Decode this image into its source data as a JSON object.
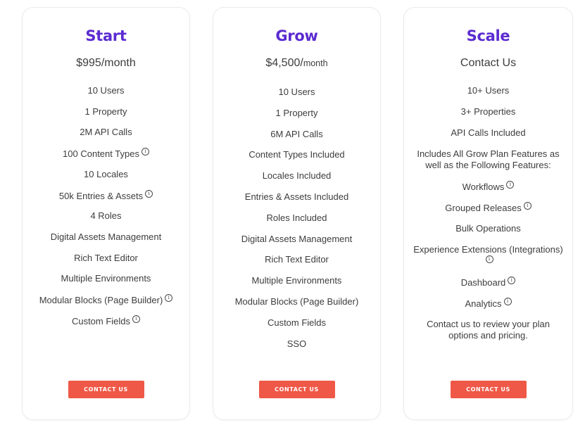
{
  "plans": [
    {
      "title": "Start",
      "price": "$995/month",
      "price_main": "$995/month",
      "price_unit": "",
      "features": [
        {
          "text": "10 Users",
          "info": false
        },
        {
          "text": "1 Property",
          "info": false
        },
        {
          "text": "2M API Calls",
          "info": false
        },
        {
          "text": "100 Content Types",
          "info": true
        },
        {
          "text": "10 Locales",
          "info": false
        },
        {
          "text": "50k Entries & Assets",
          "info": true
        },
        {
          "text": "4 Roles",
          "info": false
        },
        {
          "text": "Digital Assets Management",
          "info": false
        },
        {
          "text": "Rich Text Editor",
          "info": false
        },
        {
          "text": "Multiple Environments",
          "info": false
        },
        {
          "text": "Modular Blocks (Page Builder)",
          "info": true
        },
        {
          "text": "Custom Fields",
          "info": true
        }
      ],
      "cta_label": "CONTACT US"
    },
    {
      "title": "Grow",
      "price_main": "$4,500/",
      "price_unit": "month",
      "features": [
        {
          "text": "10 Users",
          "info": false
        },
        {
          "text": "1 Property",
          "info": false
        },
        {
          "text": "6M API Calls",
          "info": false
        },
        {
          "text": "Content Types Included",
          "info": false
        },
        {
          "text": "Locales Included",
          "info": false
        },
        {
          "text": "Entries & Assets Included",
          "info": false
        },
        {
          "text": "Roles Included",
          "info": false
        },
        {
          "text": "Digital Assets Management",
          "info": false
        },
        {
          "text": "Rich Text Editor",
          "info": false
        },
        {
          "text": "Multiple Environments",
          "info": false
        },
        {
          "text": "Modular Blocks (Page Builder)",
          "info": false
        },
        {
          "text": "Custom Fields",
          "info": false
        },
        {
          "text": "SSO",
          "info": false
        }
      ],
      "cta_label": "CONTACT US"
    },
    {
      "title": "Scale",
      "price_main": "Contact Us",
      "price_unit": "",
      "features": [
        {
          "text": "10+ Users",
          "info": false
        },
        {
          "text": "3+ Properties",
          "info": false
        },
        {
          "text": "API Calls Included",
          "info": false
        },
        {
          "text": "Includes All Grow Plan Features as well as the Following Features:",
          "info": false,
          "lines": 2
        },
        {
          "text": "Workflows",
          "info": true
        },
        {
          "text": "Grouped Releases",
          "info": true
        },
        {
          "text": "Bulk Operations",
          "info": false
        },
        {
          "text": "Experience Extensions (Integrations)",
          "info": true,
          "lines": 2
        },
        {
          "text": "Dashboard",
          "info": true
        },
        {
          "text": "Analytics",
          "info": true
        },
        {
          "text": "Contact us to review your plan options and pricing.",
          "info": false,
          "lines": 2
        }
      ],
      "cta_label": "CONTACT US"
    }
  ],
  "icons": {
    "info": "i"
  },
  "colors": {
    "title": "#5b2bd1",
    "cta_background": "#ef5847",
    "cta_text": "#ffffff",
    "body_text": "#3d3d3d"
  }
}
